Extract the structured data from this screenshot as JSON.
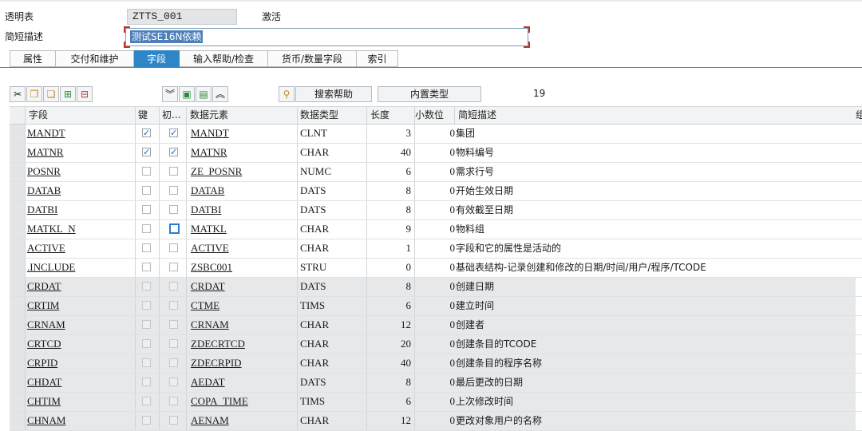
{
  "header": {
    "table_label": "透明表",
    "table_name": "ZTTS_001",
    "status": "激活",
    "desc_label": "简短描述",
    "desc_value": "测试SE16N依赖"
  },
  "tabs": [
    {
      "label": "属性",
      "active": false
    },
    {
      "label": "交付和维护",
      "active": false
    },
    {
      "label": "字段",
      "active": true
    },
    {
      "label": "输入帮助/检查",
      "active": false
    },
    {
      "label": "货币/数量字段",
      "active": false
    },
    {
      "label": "索引",
      "active": false
    }
  ],
  "toolbar": {
    "icons_left": [
      "cut-icon",
      "copy-icon",
      "paste-icon",
      "insert-row-icon",
      "delete-row-icon"
    ],
    "icons_mid": [
      "expand-all-icon",
      "new-rows-icon",
      "detail-icon",
      "collapse-all-icon"
    ],
    "search_help_label": "搜索帮助",
    "builtin_type_label": "内置类型",
    "row_count": "19"
  },
  "columns": {
    "field": "字段",
    "key": "键",
    "init": "初...",
    "data_element": "数据元素",
    "data_type": "数据类型",
    "length": "长度",
    "decimals": "小数位",
    "short_desc": "简短描述",
    "extra": "组"
  },
  "rows": [
    {
      "field": "MANDT",
      "key": true,
      "init": true,
      "de": "MANDT",
      "type": "CLNT",
      "len": "3",
      "dec": "0",
      "desc": "集团"
    },
    {
      "field": "MATNR",
      "key": true,
      "init": true,
      "de": "MATNR",
      "type": "CHAR",
      "len": "40",
      "dec": "0",
      "desc": "物料编号"
    },
    {
      "field": "POSNR",
      "key": false,
      "init": false,
      "de": "ZE_POSNR",
      "type": "NUMC",
      "len": "6",
      "dec": "0",
      "desc": "需求行号"
    },
    {
      "field": "DATAB",
      "key": false,
      "init": false,
      "de": "DATAB",
      "type": "DATS",
      "len": "8",
      "dec": "0",
      "desc": "开始生效日期"
    },
    {
      "field": "DATBI",
      "key": false,
      "init": false,
      "de": "DATBI",
      "type": "DATS",
      "len": "8",
      "dec": "0",
      "desc": "有效截至日期"
    },
    {
      "field": "MATKL_N",
      "key": false,
      "init": false,
      "de": "MATKL",
      "type": "CHAR",
      "len": "9",
      "dec": "0",
      "desc": "物料组"
    },
    {
      "field": "ACTIVE",
      "key": false,
      "init": false,
      "de": "ACTIVE",
      "type": "CHAR",
      "len": "1",
      "dec": "0",
      "desc": "字段和它的属性是活动的"
    },
    {
      "field": ".INCLUDE",
      "key": false,
      "init": false,
      "de": "ZSBC001",
      "type": "STRU",
      "len": "0",
      "dec": "0",
      "desc": "基础表结构-记录创建和修改的日期/时间/用户/程序/TCODE"
    },
    {
      "field": "CRDAT",
      "key": false,
      "init": false,
      "de": "CRDAT",
      "type": "DATS",
      "len": "8",
      "dec": "0",
      "desc": "创建日期"
    },
    {
      "field": "CRTIM",
      "key": false,
      "init": false,
      "de": "CTME",
      "type": "TIMS",
      "len": "6",
      "dec": "0",
      "desc": "建立时间"
    },
    {
      "field": "CRNAM",
      "key": false,
      "init": false,
      "de": "CRNAM",
      "type": "CHAR",
      "len": "12",
      "dec": "0",
      "desc": "创建者"
    },
    {
      "field": "CRTCD",
      "key": false,
      "init": false,
      "de": "ZDECRTCD",
      "type": "CHAR",
      "len": "20",
      "dec": "0",
      "desc": "创建条目的TCODE"
    },
    {
      "field": "CRPID",
      "key": false,
      "init": false,
      "de": "ZDECRPID",
      "type": "CHAR",
      "len": "40",
      "dec": "0",
      "desc": "创建条目的程序名称"
    },
    {
      "field": "CHDAT",
      "key": false,
      "init": false,
      "de": "AEDAT",
      "type": "DATS",
      "len": "8",
      "dec": "0",
      "desc": "最后更改的日期"
    },
    {
      "field": "CHTIM",
      "key": false,
      "init": false,
      "de": "COPA_TIME",
      "type": "TIMS",
      "len": "6",
      "dec": "0",
      "desc": "上次修改时间"
    },
    {
      "field": "CHNAM",
      "key": false,
      "init": false,
      "de": "AENAM",
      "type": "CHAR",
      "len": "12",
      "dec": "0",
      "desc": "更改对象用户的名称"
    }
  ],
  "colors": {
    "tab_active": "#2f86c6",
    "selection": "#4f7fba",
    "required_marker": "#c0342b"
  }
}
